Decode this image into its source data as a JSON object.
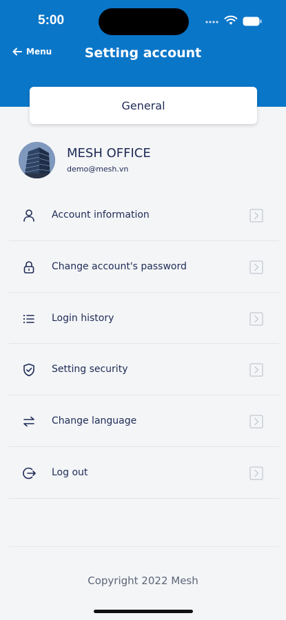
{
  "status_bar": {
    "time": "5:00",
    "icons": [
      "signal-icon",
      "wifi-icon",
      "battery-icon"
    ]
  },
  "nav": {
    "back_label": "Menu",
    "title": "Setting account"
  },
  "tab": {
    "label": "General"
  },
  "profile": {
    "name": "MESH OFFICE",
    "email": "demo@mesh.vn"
  },
  "menu": {
    "items": [
      {
        "label": "Account information",
        "icon": "user-icon"
      },
      {
        "label": "Change account's password",
        "icon": "lock-icon"
      },
      {
        "label": "Login history",
        "icon": "list-icon"
      },
      {
        "label": "Setting security",
        "icon": "shield-check-icon"
      },
      {
        "label": "Change language",
        "icon": "swap-arrows-icon"
      },
      {
        "label": "Log out",
        "icon": "logout-icon"
      }
    ]
  },
  "footer": {
    "copyright": "Copyright 2022 Mesh"
  },
  "colors": {
    "header": "#0a76c8",
    "background": "#f4f5f7",
    "text": "#1d2a55"
  }
}
